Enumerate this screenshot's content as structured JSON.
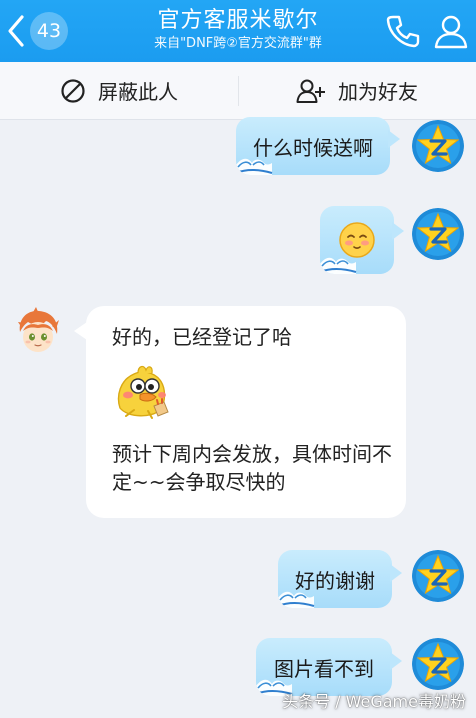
{
  "header": {
    "unread_count": "43",
    "title": "官方客服米歇尔",
    "subtitle": "来自\"DNF跨②官方交流群\"群"
  },
  "actions": {
    "block_label": "屏蔽此人",
    "add_friend_label": "加为好友"
  },
  "messages": [
    {
      "side": "out",
      "text": "什么时候送啊"
    },
    {
      "side": "out",
      "type": "emoji",
      "icon": "blush-face-emoji"
    },
    {
      "side": "in",
      "line1": "好的，已经登记了哈",
      "sticker": "yellow-duck-sticker",
      "line2": "预计下周内会发放，具体时间不定~~会争取尽快的"
    },
    {
      "side": "out",
      "text": "好的谢谢"
    },
    {
      "side": "out",
      "text": "图片看不到"
    }
  ],
  "watermark": "头条号 / WeGame毒奶粉",
  "colors": {
    "header_bg": "#1b9cf0",
    "bubble_out": "#a7dcfa",
    "bubble_in": "#ffffff",
    "chat_bg": "#eef1f6"
  }
}
